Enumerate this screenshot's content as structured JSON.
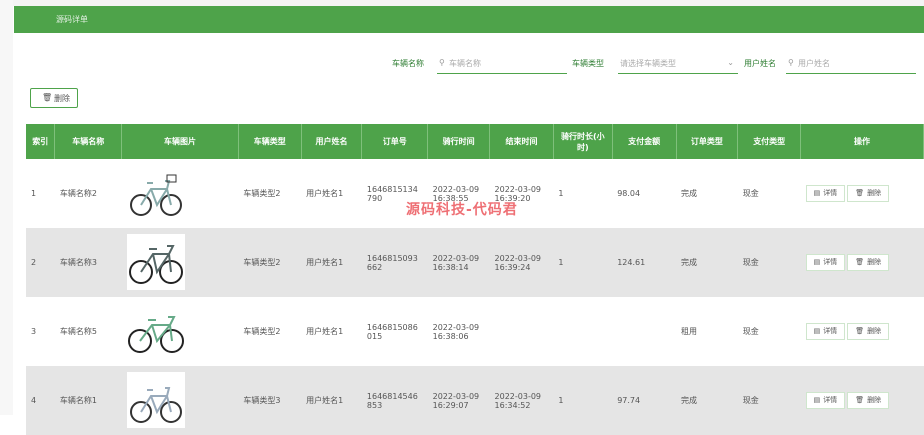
{
  "header": {
    "breadcrumb": "源码详单"
  },
  "filters": {
    "vehicle_name_label": "车辆名称",
    "vehicle_name_placeholder": "车辆名称",
    "vehicle_type_label": "车辆类型",
    "vehicle_type_placeholder": "请选择车辆类型",
    "user_name_label": "用户姓名",
    "user_name_placeholder": "用户姓名"
  },
  "toolbar": {
    "delete_label": "删除"
  },
  "table": {
    "headers": [
      "索引",
      "车辆名称",
      "车辆图片",
      "车辆类型",
      "用户姓名",
      "订单号",
      "骑行时间",
      "结束时间",
      "骑行时长(小时)",
      "支付金额",
      "订单类型",
      "支付类型",
      "操作"
    ],
    "rows": [
      {
        "index": "1",
        "name": "车辆名称2",
        "type": "车辆类型2",
        "user": "用户姓名1",
        "order_no": "1646815134790",
        "start": "2022-03-09 16:38:55",
        "end": "2022-03-09 16:39:20",
        "duration": "1",
        "amount": "98.04",
        "order_type": "完成",
        "pay_type": "现金"
      },
      {
        "index": "2",
        "name": "车辆名称3",
        "type": "车辆类型2",
        "user": "用户姓名1",
        "order_no": "1646815093662",
        "start": "2022-03-09 16:38:14",
        "end": "2022-03-09 16:39:24",
        "duration": "1",
        "amount": "124.61",
        "order_type": "完成",
        "pay_type": "现金"
      },
      {
        "index": "3",
        "name": "车辆名称5",
        "type": "车辆类型2",
        "user": "用户姓名1",
        "order_no": "1646815086015",
        "start": "2022-03-09 16:38:06",
        "end": "",
        "duration": "",
        "amount": "",
        "order_type": "租用",
        "pay_type": "现金"
      },
      {
        "index": "4",
        "name": "车辆名称1",
        "type": "车辆类型3",
        "user": "用户姓名1",
        "order_no": "1646814546853",
        "start": "2022-03-09 16:29:07",
        "end": "2022-03-09 16:34:52",
        "duration": "1",
        "amount": "97.74",
        "order_type": "完成",
        "pay_type": "现金"
      }
    ],
    "detail_label": "详情",
    "delete_label": "删除"
  },
  "watermark": "源码科技-代码君",
  "colors": {
    "primary": "#4ea34a",
    "row_alt": "#e5e5e5",
    "watermark": "#e8333a"
  },
  "icons": {
    "search": "search-icon",
    "delete": "trash-icon",
    "detail": "document-icon",
    "dropdown": "chevron-down-icon"
  }
}
